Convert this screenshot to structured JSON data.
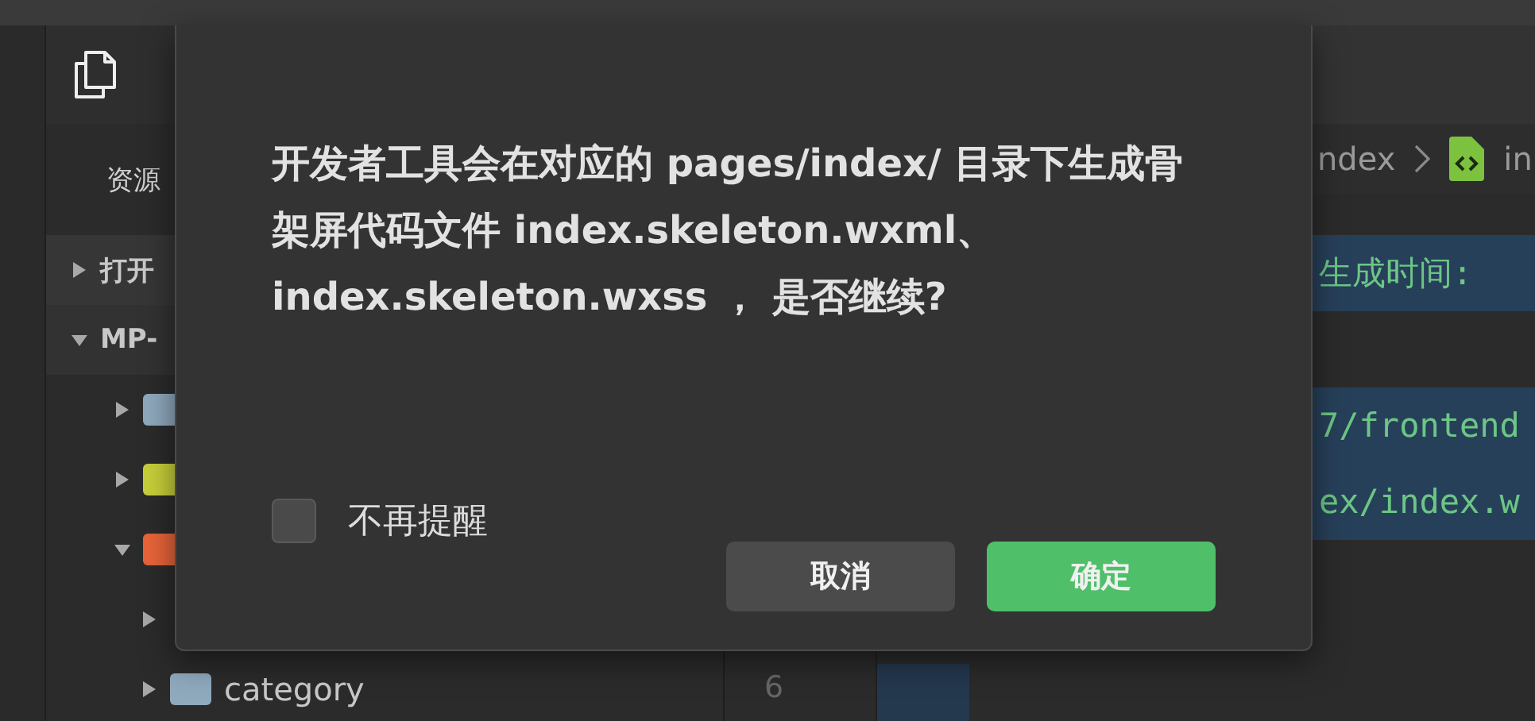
{
  "sidebar": {
    "title": "资源",
    "items": [
      {
        "label": "打开",
        "expanded": false
      },
      {
        "label": "MP-",
        "expanded": true,
        "children": [
          {
            "color": "#8fa9bd",
            "expanded": false
          },
          {
            "color": "#c8cf3a",
            "expanded": false
          },
          {
            "color": "#e8643a",
            "expanded": true,
            "children": [
              {
                "expanded": false
              },
              {
                "label": "category",
                "color": "#8fa9bd",
                "expanded": false
              }
            ]
          }
        ]
      }
    ]
  },
  "editor": {
    "breadcrumb": [
      "ndex",
      "in"
    ],
    "lines": [
      {
        "text": "生成时间:",
        "highlighted": true
      },
      {
        "highlighted": false
      },
      {
        "text": "7/frontend",
        "highlighted": true
      },
      {
        "text": "ex/index.w",
        "highlighted": true
      }
    ],
    "gutter_number": "6"
  },
  "dialog": {
    "message": "开发者工具会在对应的 pages/index/ 目录下生成骨架屏代码文件 index.skeleton.wxml、index.skeleton.wxss ， 是否继续?",
    "checkbox": {
      "label": "不再提醒",
      "checked": false
    },
    "buttons": [
      {
        "label": "取消",
        "kind": "secondary"
      },
      {
        "label": "确定",
        "kind": "primary"
      }
    ]
  }
}
